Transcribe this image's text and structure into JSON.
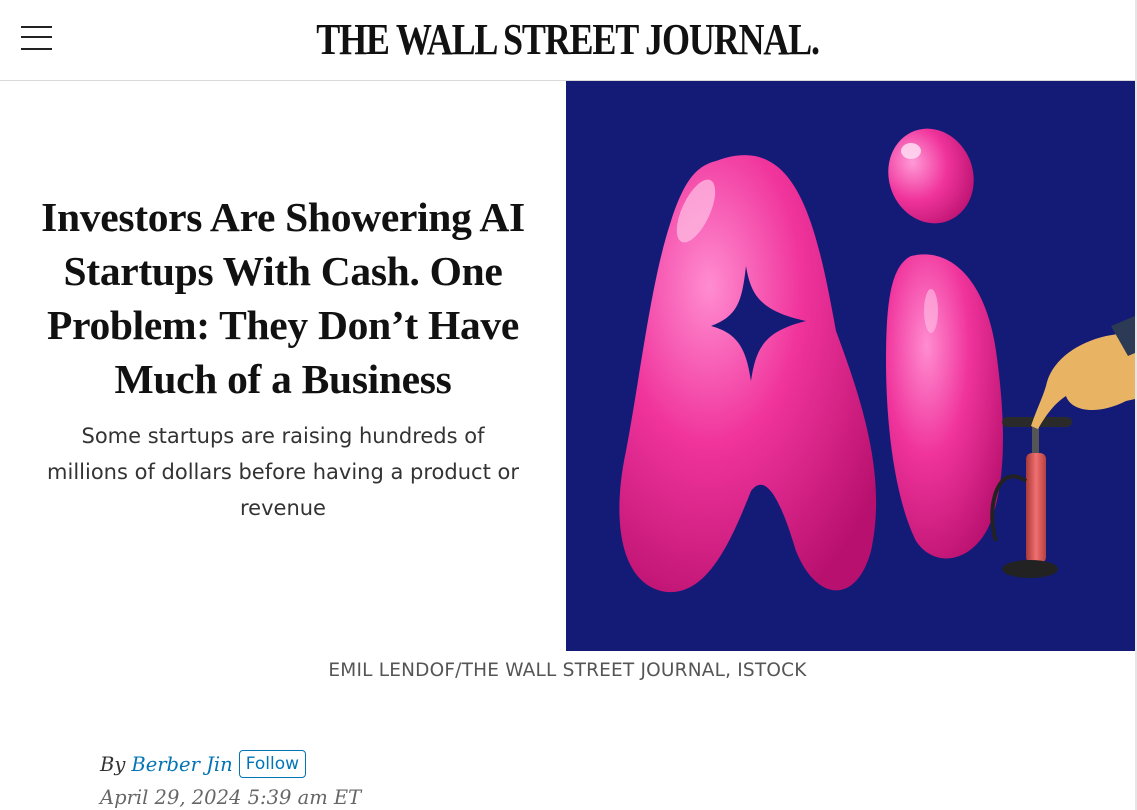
{
  "header": {
    "masthead": "THE WALL STREET JOURNAL."
  },
  "article": {
    "headline": "Investors Are Showering AI Startups With Cash. One Problem: They Don’t Have Much of a Business",
    "dek": "Some startups are raising hundreds of millions of dollars before having a product or revenue",
    "image_credit": "EMIL LENDOF/THE WALL STREET JOURNAL, ISTOCK",
    "byline_prefix": "By",
    "author": "Berber Jin",
    "follow_label": "Follow",
    "timestamp": "April 29, 2024 5:39 am ET"
  },
  "colors": {
    "link": "#0274b6",
    "image_background": "#131b77",
    "balloon_pink": "#f0349c"
  },
  "icons": {
    "menu": "hamburger-menu-icon"
  }
}
